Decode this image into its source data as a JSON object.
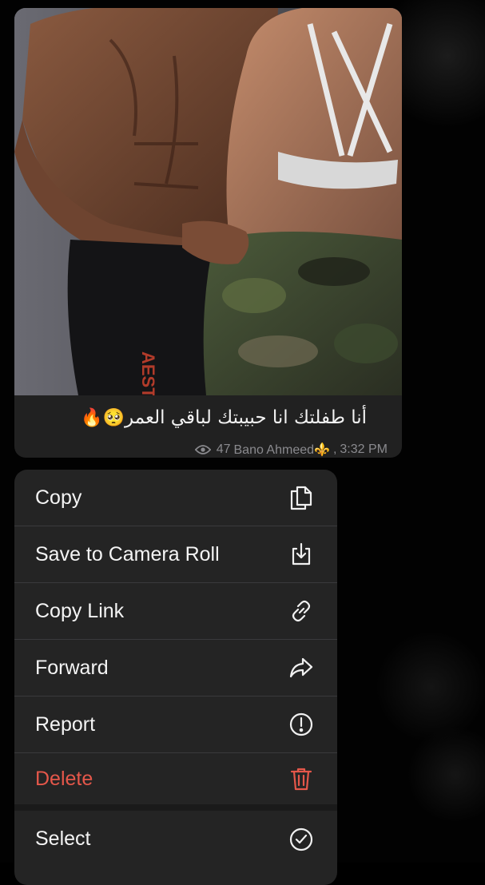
{
  "message": {
    "caption_text": "أنا طفلتك انا حبيبتك لباقي العمر",
    "caption_emoji": "🥺🔥",
    "views": "47",
    "author": "Bano Ahmeed⚜️",
    "separator": ",",
    "time": "3:32 PM",
    "photo_print": "AEST"
  },
  "context_menu": {
    "items": [
      {
        "label": "Copy",
        "icon": "copy-icon"
      },
      {
        "label": "Save to Camera Roll",
        "icon": "download-icon"
      },
      {
        "label": "Copy Link",
        "icon": "link-icon"
      },
      {
        "label": "Forward",
        "icon": "forward-icon"
      },
      {
        "label": "Report",
        "icon": "report-icon"
      },
      {
        "label": "Delete",
        "icon": "trash-icon",
        "color": "#e5574a"
      },
      {
        "label": "Select",
        "icon": "check-circle-icon"
      }
    ]
  },
  "colors": {
    "background": "#000000",
    "bubble": "#212121",
    "menu": "#242424",
    "danger": "#e5574a",
    "meta_text": "#8a8a8e"
  }
}
